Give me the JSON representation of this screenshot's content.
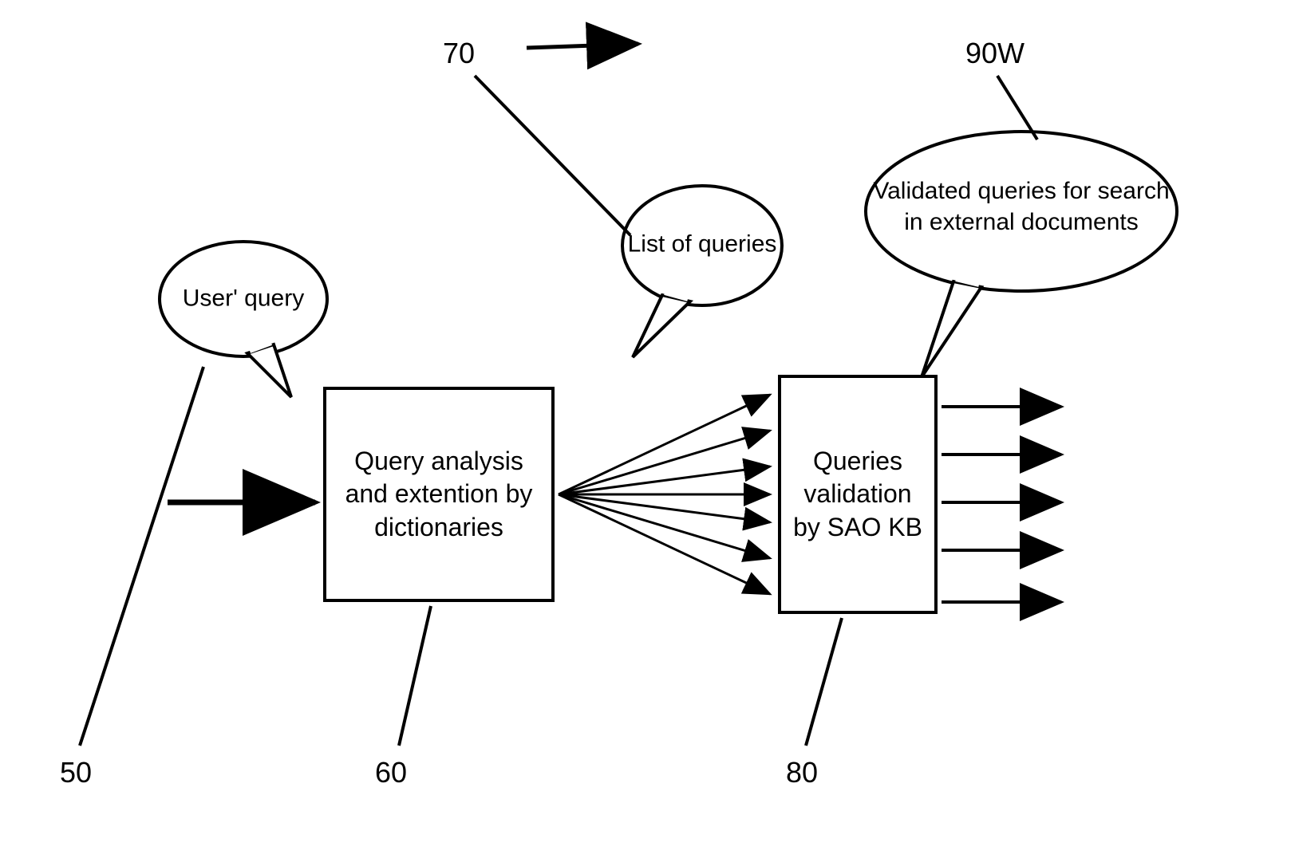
{
  "labels": {
    "ref50": "50",
    "ref60": "60",
    "ref70": "70",
    "ref80": "80",
    "ref90w": "90W"
  },
  "bubbles": {
    "userQuery": "User' query",
    "listOfQueries": "List of queries",
    "validatedQueries": "Validated queries for search in external documents"
  },
  "boxes": {
    "queryAnalysis": "Query analysis and extention by dictionaries",
    "queriesValidation": "Queries validation by SAO KB"
  }
}
